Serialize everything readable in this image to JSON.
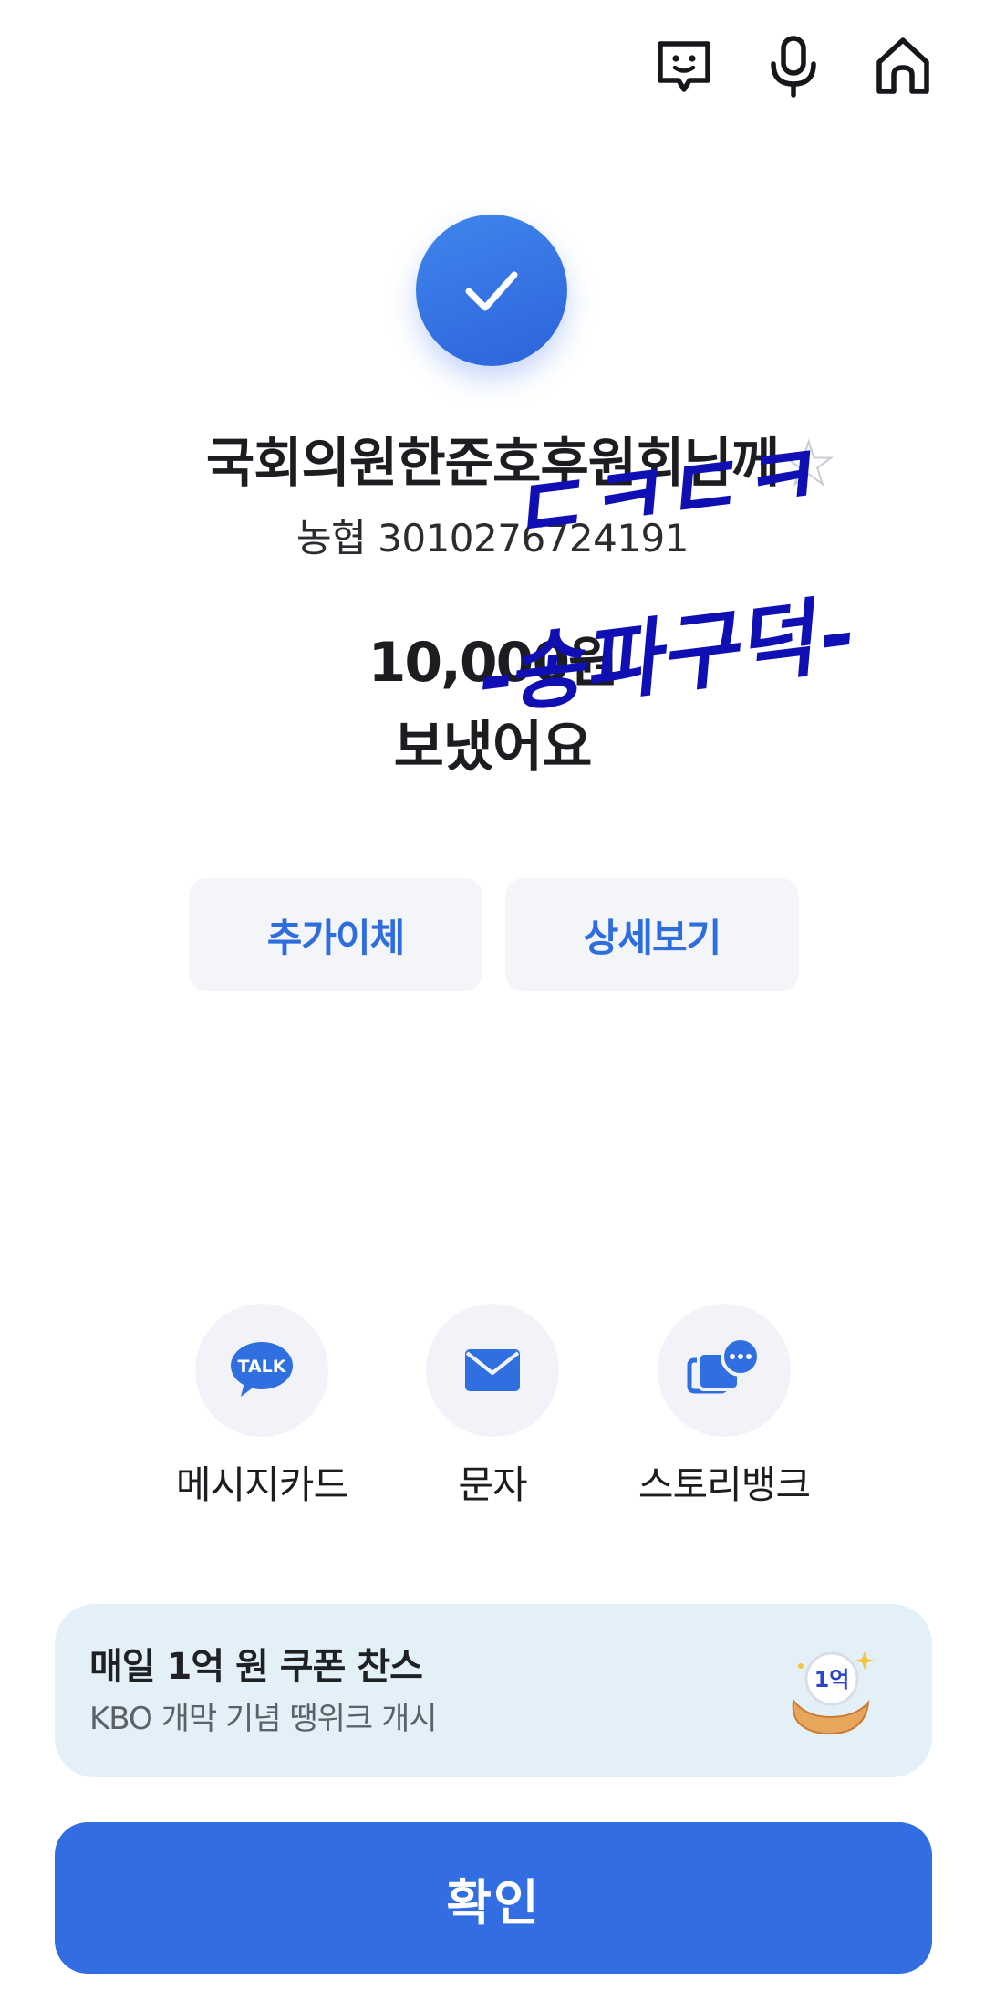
{
  "topbar": {
    "icons": [
      "chat-face-icon",
      "microphone-icon",
      "home-icon"
    ]
  },
  "status": {
    "icon": "check-icon",
    "color": "#326ee2"
  },
  "transfer": {
    "recipient": "국회의원한준호후원회님께",
    "account": "농협 3010276724191",
    "amount": "10,000원",
    "sent_text": "보냈어요"
  },
  "sticker": {
    "line1": "ㄷㅋㄷㅋ",
    "line2": "-송파구덕-",
    "color": "#0f0fb4"
  },
  "actions": {
    "additional_transfer": "추가이체",
    "view_details": "상세보기"
  },
  "share": {
    "items": [
      {
        "label": "메시지카드",
        "icon": "kakaotalk-icon",
        "badge": "TALK"
      },
      {
        "label": "문자",
        "icon": "mail-icon"
      },
      {
        "label": "스토리뱅크",
        "icon": "storybank-icon"
      }
    ]
  },
  "promo": {
    "title": "매일 1억 원 쿠폰 찬스",
    "subtitle": "KBO 개막 기념 땡위크 개시",
    "badge": "1억"
  },
  "confirm": {
    "label": "확인"
  },
  "colors": {
    "accent": "#326ee2",
    "button_bg": "#f3f5f9",
    "promo_bg": "#e3f0f8"
  }
}
